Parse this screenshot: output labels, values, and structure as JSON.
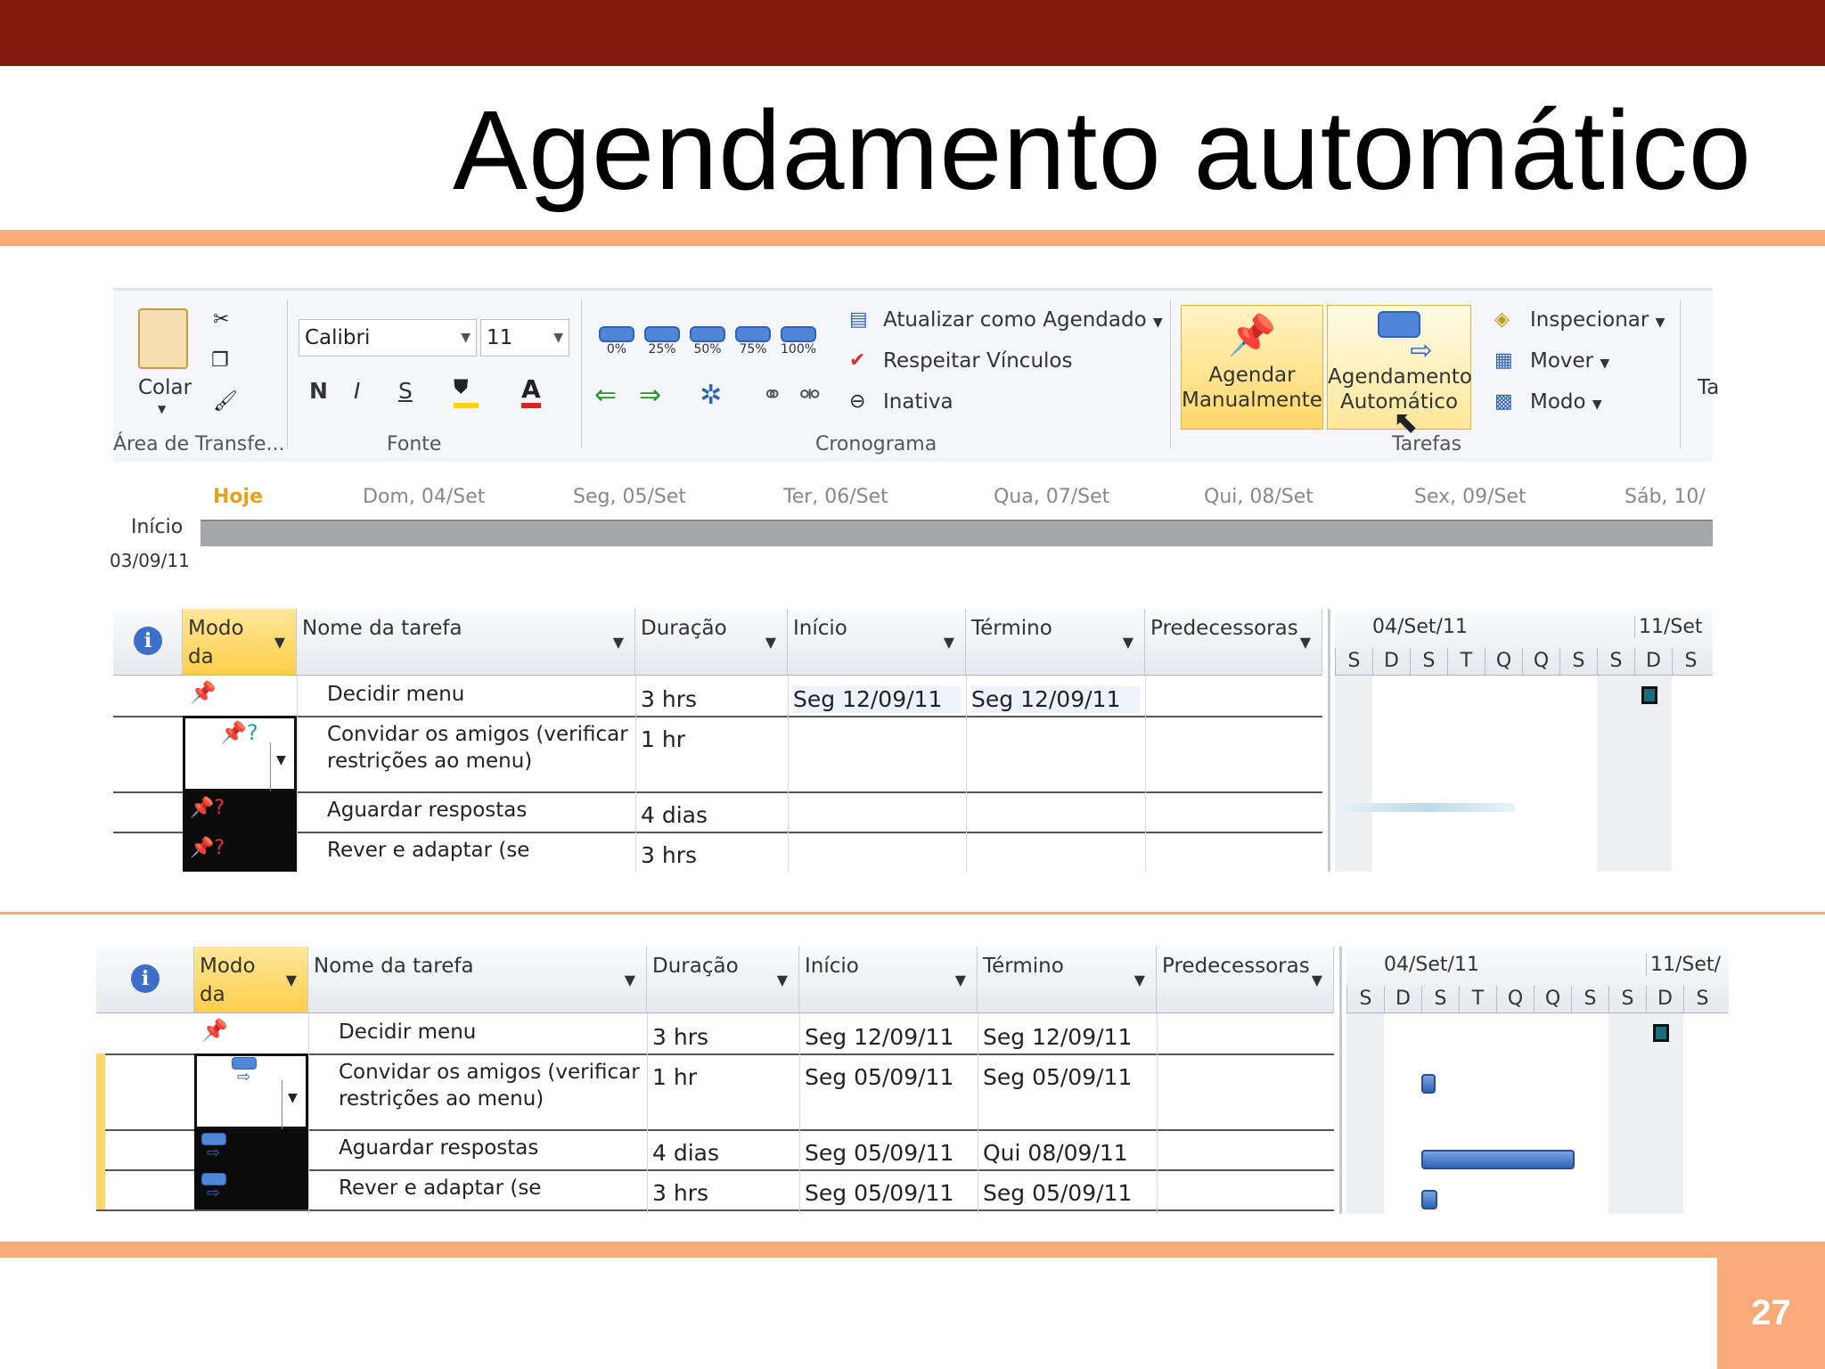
{
  "slide": {
    "title": "Agendamento automático",
    "page_number": "27"
  },
  "ribbon": {
    "clipboard": {
      "paste_label": "Colar",
      "group_label": "Área de Transfe..."
    },
    "font": {
      "font_name": "Calibri",
      "font_size": "11",
      "bold": "N",
      "italic": "I",
      "underline": "S",
      "fill_icon": "paint-bucket-icon",
      "font_color": "A",
      "group_label": "Fonte"
    },
    "schedule": {
      "percent_labels": [
        "0%",
        "25%",
        "50%",
        "75%",
        "100%"
      ],
      "update_as_scheduled": "Atualizar como Agendado",
      "respect_links": "Respeitar Vínculos",
      "inactive": "Inativa",
      "group_label": "Cronograma"
    },
    "tasks": {
      "manual_label_1": "Agendar",
      "manual_label_2": "Manualmente",
      "auto_label_1": "Agendamento",
      "auto_label_2": "Automático",
      "inspect": "Inspecionar",
      "move": "Mover",
      "mode": "Modo",
      "group_label": "Tarefas",
      "clipped_next": "Ta"
    }
  },
  "timeline": {
    "today": "Hoje",
    "start_label": "Início",
    "start_date": "03/09/11",
    "dates": [
      "Dom, 04/Set",
      "Seg, 05/Set",
      "Ter, 06/Set",
      "Qua, 07/Set",
      "Qui, 08/Set",
      "Sex, 09/Set",
      "Sáb, 10/"
    ]
  },
  "table_headers": {
    "info": "i",
    "mode": "Modo da",
    "name": "Nome da tarefa",
    "duration": "Duração",
    "start": "Início",
    "finish": "Término",
    "predecessors": "Predecessoras"
  },
  "gantt_header": {
    "week1": "04/Set/11",
    "week2": "11/Set",
    "week2b": "11/Set/",
    "days": [
      "S",
      "D",
      "S",
      "T",
      "Q",
      "Q",
      "S",
      "S",
      "D",
      "S"
    ]
  },
  "table_before": {
    "rows": [
      {
        "name": "Decidir menu",
        "duration": "3 hrs",
        "start": "Seg 12/09/11",
        "finish": "Seg 12/09/11",
        "mode_icon": "pin-icon"
      },
      {
        "name": "Convidar os amigos (verificar restrições ao menu)",
        "duration": "1 hr",
        "start": "",
        "finish": "",
        "mode_icon": "pin-question-icon"
      },
      {
        "name": "Aguardar respostas",
        "duration": "4 dias",
        "start": "",
        "finish": "",
        "mode_icon": "red-pin-question-icon"
      },
      {
        "name": "Rever e adaptar (se",
        "duration": "3 hrs",
        "start": "",
        "finish": "",
        "mode_icon": "red-pin-question-icon"
      }
    ]
  },
  "table_after": {
    "rows": [
      {
        "name": "Decidir menu",
        "duration": "3 hrs",
        "start": "Seg 12/09/11",
        "finish": "Seg 12/09/11",
        "mode_icon": "pin-icon"
      },
      {
        "name": "Convidar os amigos (verificar restrições ao menu)",
        "duration": "1 hr",
        "start": "Seg 05/09/11",
        "finish": "Seg 05/09/11",
        "mode_icon": "auto-schedule-icon"
      },
      {
        "name": "Aguardar respostas",
        "duration": "4 dias",
        "start": "Seg 05/09/11",
        "finish": "Qui 08/09/11",
        "mode_icon": "auto-schedule-icon"
      },
      {
        "name": "Rever e adaptar (se",
        "duration": "3 hrs",
        "start": "Seg 05/09/11",
        "finish": "Seg 05/09/11",
        "mode_icon": "auto-schedule-icon"
      }
    ]
  },
  "colors": {
    "header_bar": "#7f1a0c",
    "accent_line": "#f8ab78",
    "highlight": "#ffd768",
    "gantt_bar": "#2f63b8"
  }
}
